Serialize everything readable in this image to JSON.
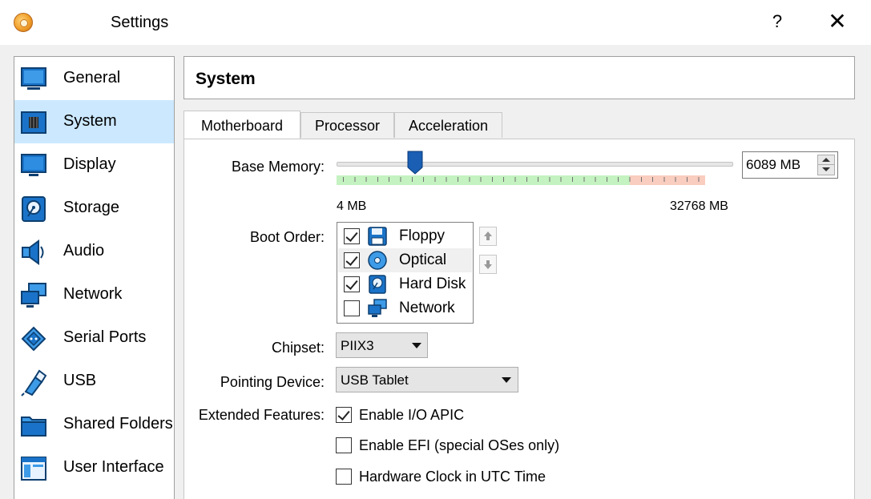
{
  "window": {
    "title": "Settings",
    "help_label": "?",
    "close_label": "✕"
  },
  "sidebar": {
    "items": [
      {
        "label": "General",
        "icon": "general-icon",
        "selected": false
      },
      {
        "label": "System",
        "icon": "system-icon",
        "selected": true
      },
      {
        "label": "Display",
        "icon": "display-icon",
        "selected": false
      },
      {
        "label": "Storage",
        "icon": "storage-icon",
        "selected": false
      },
      {
        "label": "Audio",
        "icon": "audio-icon",
        "selected": false
      },
      {
        "label": "Network",
        "icon": "network-icon",
        "selected": false
      },
      {
        "label": "Serial Ports",
        "icon": "serial-ports-icon",
        "selected": false
      },
      {
        "label": "USB",
        "icon": "usb-icon",
        "selected": false
      },
      {
        "label": "Shared Folders",
        "icon": "shared-folders-icon",
        "selected": false
      },
      {
        "label": "User Interface",
        "icon": "user-interface-icon",
        "selected": false
      }
    ]
  },
  "page": {
    "title": "System"
  },
  "tabs": [
    {
      "label": "Motherboard",
      "active": true
    },
    {
      "label": "Processor",
      "active": false
    },
    {
      "label": "Acceleration",
      "active": false
    }
  ],
  "motherboard": {
    "base_memory": {
      "label": "Base Memory:",
      "value": "6089 MB",
      "min_label": "4 MB",
      "max_label": "32768 MB",
      "slider_fraction": 0.186
    },
    "boot_order": {
      "label": "Boot Order:",
      "items": [
        {
          "label": "Floppy",
          "checked": true,
          "icon": "floppy-icon"
        },
        {
          "label": "Optical",
          "checked": true,
          "icon": "optical-icon"
        },
        {
          "label": "Hard Disk",
          "checked": true,
          "icon": "hard-disk-icon"
        },
        {
          "label": "Network",
          "checked": false,
          "icon": "network-icon"
        }
      ]
    },
    "chipset": {
      "label": "Chipset:",
      "value": "PIIX3"
    },
    "pointing_device": {
      "label": "Pointing Device:",
      "value": "USB Tablet"
    },
    "extended_features": {
      "label": "Extended Features:",
      "options": [
        {
          "label": "Enable I/O APIC",
          "checked": true
        },
        {
          "label": "Enable EFI (special OSes only)",
          "checked": false
        },
        {
          "label": "Hardware Clock in UTC Time",
          "checked": false
        }
      ]
    }
  },
  "colors": {
    "selection": "#cce8ff",
    "slider_handle": "#1a5fb4",
    "scale_safe": "#c4f2c0",
    "scale_danger": "#f9cdbf"
  }
}
